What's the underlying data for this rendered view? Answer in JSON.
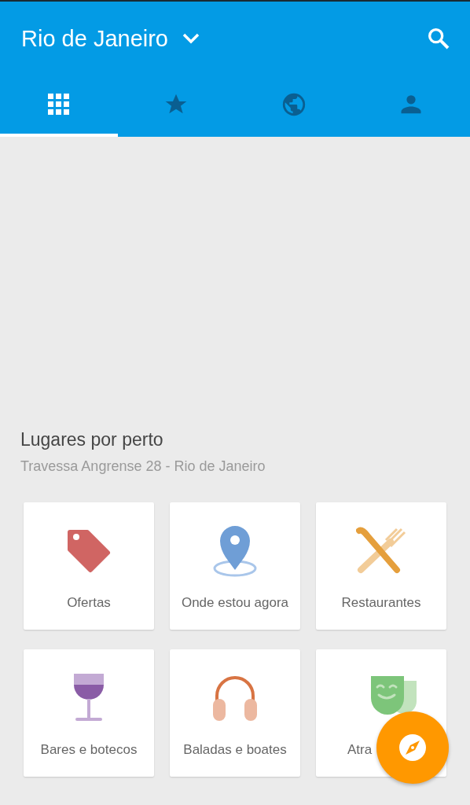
{
  "app_bar": {
    "title": "Rio de Janeiro"
  },
  "tabs": [
    {
      "kind": "grid",
      "selected": true
    },
    {
      "kind": "star",
      "selected": false
    },
    {
      "kind": "globe",
      "selected": false
    },
    {
      "kind": "person",
      "selected": false
    }
  ],
  "section": {
    "title": "Lugares por perto",
    "subtitle": "Travessa Angrense 28 - Rio de Janeiro"
  },
  "categories": [
    {
      "kind": "tag",
      "label": "Ofertas"
    },
    {
      "kind": "pin",
      "label": "Onde estou agora"
    },
    {
      "kind": "cutlery",
      "label": "Restaurantes"
    },
    {
      "kind": "glass",
      "label": "Bares e botecos"
    },
    {
      "kind": "headphones",
      "label": "Baladas e boates"
    },
    {
      "kind": "masks",
      "label": "Atra"
    }
  ]
}
